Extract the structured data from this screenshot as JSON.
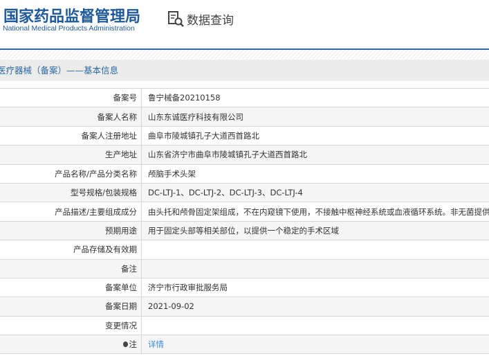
{
  "header": {
    "logo_cn": "国家药品监督管理局",
    "logo_en": "National Medical Products Administration",
    "query": "数据查询"
  },
  "section_title": "医疗器械（备案）——基本信息",
  "rows": [
    {
      "label": "备案号",
      "value": "鲁宁械备20210158"
    },
    {
      "label": "备案人名称",
      "value": "山东东诚医疗科技有限公司"
    },
    {
      "label": "备案人注册地址",
      "value": "曲阜市陵城镇孔子大道西首路北"
    },
    {
      "label": "生产地址",
      "value": "山东省济宁市曲阜市陵城镇孔子大道西首路北"
    },
    {
      "label": "产品名称/产品分类名称",
      "value": "颅脑手术头架"
    },
    {
      "label": "型号规格/包装规格",
      "value": "DC-LTJ-1、DC-LTJ-2、DC-LTJ-3、DC-LTJ-4"
    },
    {
      "label": "产品描述/主要组成成分",
      "value": "由头托和颅骨固定架组成，不在内窥镜下使用，不接触中枢神经系统或血液循环系统。非无菌提供。"
    },
    {
      "label": "预期用途",
      "value": "用于固定头部等相关部位，以提供一个稳定的手术区域"
    },
    {
      "label": "产品存储及有效期",
      "value": ""
    },
    {
      "label": "备注",
      "value": ""
    },
    {
      "label": "备案单位",
      "value": "济宁市行政审批服务局"
    },
    {
      "label": "备案日期",
      "value": "2021-09-02"
    },
    {
      "label": "变更情况",
      "value": ""
    },
    {
      "label": "注",
      "value": "详情"
    }
  ]
}
